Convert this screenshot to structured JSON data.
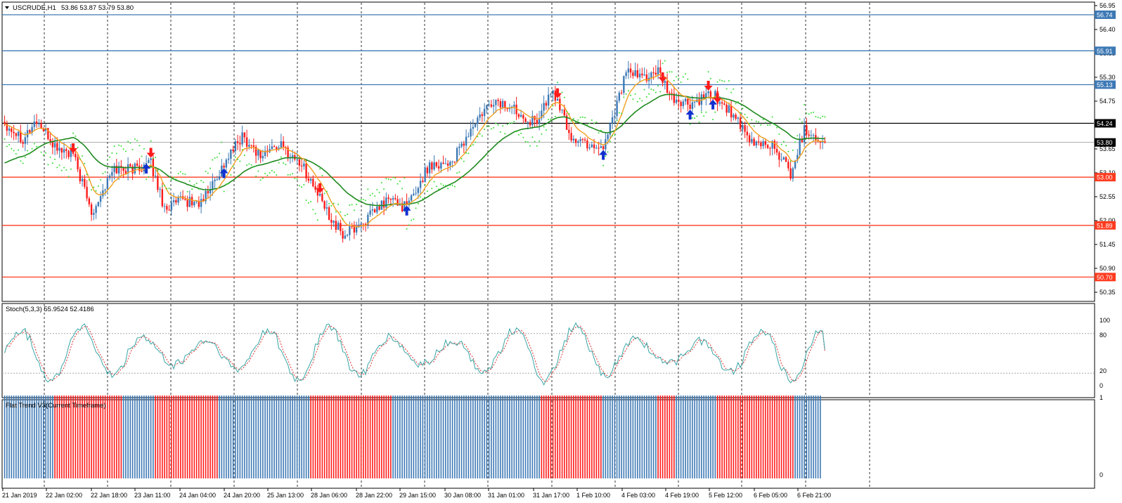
{
  "header": {
    "symbol": "USCRUDE,H1",
    "ohlc": "53.86 53.87 53.79 53.80"
  },
  "stoch_label": "Stoch(5,3,3) 55.9524 52.4186",
  "flat_label": "Flat Trend V3(Current Timeframe)",
  "price_axis": [
    "56.95",
    "56.40",
    "55.85",
    "55.30",
    "54.75",
    "54.20",
    "53.65",
    "53.10",
    "52.55",
    "52.00",
    "51.45",
    "50.90",
    "50.35"
  ],
  "stoch_axis": [
    "100",
    "80",
    "20",
    "0"
  ],
  "flat_axis": [
    "1",
    "0"
  ],
  "time_axis": [
    "21 Jan 2019",
    "22 Jan 02:00",
    "22 Jan 18:00",
    "23 Jan 11:00",
    "24 Jan 04:00",
    "24 Jan 20:00",
    "25 Jan 13:00",
    "28 Jan 06:00",
    "28 Jan 22:00",
    "29 Jan 15:00",
    "30 Jan 08:00",
    "31 Jan 01:00",
    "31 Jan 17:00",
    "1 Feb 10:00",
    "4 Feb 03:00",
    "4 Feb 19:00",
    "5 Feb 12:00",
    "6 Feb 05:00",
    "6 Feb 21:00"
  ],
  "levels": [
    {
      "label": "56.74",
      "value": 56.74,
      "color": "#3d79b5"
    },
    {
      "label": "55.91",
      "value": 55.91,
      "color": "#3d79b5"
    },
    {
      "label": "55.13",
      "value": 55.13,
      "color": "#3d79b5"
    },
    {
      "label": "54.24",
      "value": 54.24,
      "color": "#000000"
    },
    {
      "label": "53.80",
      "value": 53.8,
      "color": "#000000"
    },
    {
      "label": "53.00",
      "value": 53.0,
      "color": "#ff3b1f"
    },
    {
      "label": "51.89",
      "value": 51.89,
      "color": "#ff3b1f"
    },
    {
      "label": "50.70",
      "value": 50.7,
      "color": "#ff3b1f"
    }
  ],
  "colors": {
    "bull": "#3d79b5",
    "bear": "#ff1a1a",
    "ma_fast": "#f0a020",
    "ma_slow": "#1f8a1f",
    "sar": "#33dd33",
    "stoch_main": "#3aa6a6",
    "stoch_signal": "#e03030",
    "arrow_up": "#1030d0",
    "arrow_down": "#ff1a1a"
  },
  "chart_data": {
    "type": "candlestick",
    "symbol": "USCRUDE",
    "timeframe": "H1",
    "ylim": [
      50.35,
      56.95
    ],
    "last_price": 53.8,
    "close_path": [
      {
        "bar": 0,
        "close": 54.25
      },
      {
        "bar": 8,
        "close": 53.9
      },
      {
        "bar": 14,
        "close": 54.3
      },
      {
        "bar": 22,
        "close": 53.7
      },
      {
        "bar": 30,
        "close": 53.5
      },
      {
        "bar": 38,
        "close": 52.2
      },
      {
        "bar": 48,
        "close": 53.2
      },
      {
        "bar": 56,
        "close": 53.2
      },
      {
        "bar": 64,
        "close": 53.3
      },
      {
        "bar": 70,
        "close": 52.3
      },
      {
        "bar": 78,
        "close": 52.45
      },
      {
        "bar": 86,
        "close": 52.4
      },
      {
        "bar": 96,
        "close": 53.3
      },
      {
        "bar": 104,
        "close": 53.95
      },
      {
        "bar": 112,
        "close": 53.5
      },
      {
        "bar": 120,
        "close": 53.75
      },
      {
        "bar": 130,
        "close": 53.3
      },
      {
        "bar": 140,
        "close": 52.3
      },
      {
        "bar": 148,
        "close": 51.65
      },
      {
        "bar": 158,
        "close": 52.0
      },
      {
        "bar": 168,
        "close": 52.5
      },
      {
        "bar": 176,
        "close": 52.3
      },
      {
        "bar": 186,
        "close": 53.3
      },
      {
        "bar": 196,
        "close": 53.35
      },
      {
        "bar": 206,
        "close": 54.25
      },
      {
        "bar": 214,
        "close": 54.75
      },
      {
        "bar": 224,
        "close": 54.55
      },
      {
        "bar": 232,
        "close": 54.25
      },
      {
        "bar": 240,
        "close": 55.0
      },
      {
        "bar": 248,
        "close": 53.9
      },
      {
        "bar": 256,
        "close": 53.75
      },
      {
        "bar": 262,
        "close": 53.7
      },
      {
        "bar": 272,
        "close": 55.4
      },
      {
        "bar": 278,
        "close": 55.3
      },
      {
        "bar": 286,
        "close": 55.4
      },
      {
        "bar": 292,
        "close": 54.8
      },
      {
        "bar": 300,
        "close": 54.65
      },
      {
        "bar": 310,
        "close": 54.9
      },
      {
        "bar": 318,
        "close": 54.5
      },
      {
        "bar": 326,
        "close": 53.8
      },
      {
        "bar": 336,
        "close": 53.75
      },
      {
        "bar": 344,
        "close": 53.1
      },
      {
        "bar": 350,
        "close": 54.1
      },
      {
        "bar": 358,
        "close": 53.85
      }
    ],
    "moving_averages": [
      {
        "kind": "fast",
        "color": "orange"
      },
      {
        "kind": "slow",
        "color": "green"
      }
    ],
    "signals": [
      {
        "bar": 30,
        "dir": "down"
      },
      {
        "bar": 62,
        "dir": "up"
      },
      {
        "bar": 64,
        "dir": "down"
      },
      {
        "bar": 96,
        "dir": "up"
      },
      {
        "bar": 138,
        "dir": "down"
      },
      {
        "bar": 176,
        "dir": "up"
      },
      {
        "bar": 242,
        "dir": "down"
      },
      {
        "bar": 262,
        "dir": "up"
      },
      {
        "bar": 288,
        "dir": "down"
      },
      {
        "bar": 300,
        "dir": "up"
      },
      {
        "bar": 308,
        "dir": "down"
      },
      {
        "bar": 310,
        "dir": "up"
      },
      {
        "bar": 312,
        "dir": "down"
      }
    ],
    "stochastic": {
      "k": 55.9524,
      "d": 52.4186,
      "levels": [
        20,
        80
      ]
    },
    "flat_trend_blocks": [
      {
        "from": 0,
        "to": 22,
        "state": "bull"
      },
      {
        "from": 22,
        "to": 52,
        "state": "bear"
      },
      {
        "from": 52,
        "to": 66,
        "state": "bull"
      },
      {
        "from": 66,
        "to": 94,
        "state": "bear"
      },
      {
        "from": 94,
        "to": 134,
        "state": "bull"
      },
      {
        "from": 134,
        "to": 170,
        "state": "bear"
      },
      {
        "from": 170,
        "to": 235,
        "state": "bull"
      },
      {
        "from": 235,
        "to": 262,
        "state": "bear"
      },
      {
        "from": 262,
        "to": 286,
        "state": "bull"
      },
      {
        "from": 286,
        "to": 294,
        "state": "bear"
      },
      {
        "from": 294,
        "to": 312,
        "state": "bull"
      },
      {
        "from": 312,
        "to": 346,
        "state": "bear"
      },
      {
        "from": 346,
        "to": 358,
        "state": "bull"
      }
    ]
  }
}
